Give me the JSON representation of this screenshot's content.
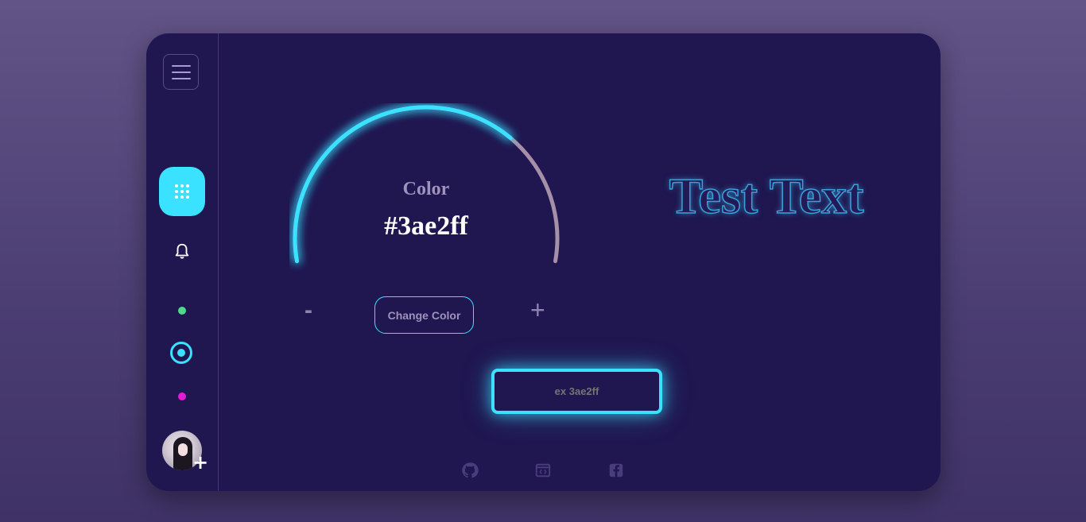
{
  "gauge": {
    "label": "Color",
    "value": "#3ae2ff",
    "minus": "-",
    "plus": "+",
    "change_button": "Change Color",
    "fill_fraction": 0.7
  },
  "preview": {
    "text": "Test Text"
  },
  "input": {
    "placeholder": "ex 3ae2ff"
  },
  "sidebar": {
    "items": [
      {
        "icon": "menu-icon"
      },
      {
        "icon": "apps-grid-icon",
        "active": true
      },
      {
        "icon": "bell-icon"
      },
      {
        "icon": "green-dot-icon"
      },
      {
        "icon": "ring-dot-icon"
      },
      {
        "icon": "pink-dot-icon"
      },
      {
        "icon": "avatar"
      }
    ],
    "avatar_add": "+"
  },
  "footer": {
    "icons": [
      "github-icon",
      "code-window-icon",
      "facebook-icon"
    ]
  },
  "colors": {
    "accent": "#3ae2ff",
    "card_bg": "#201650",
    "page_bg": "#5a4c80",
    "green": "#4fd98a",
    "pink": "#e51ad6",
    "track": "#a68fa8"
  }
}
